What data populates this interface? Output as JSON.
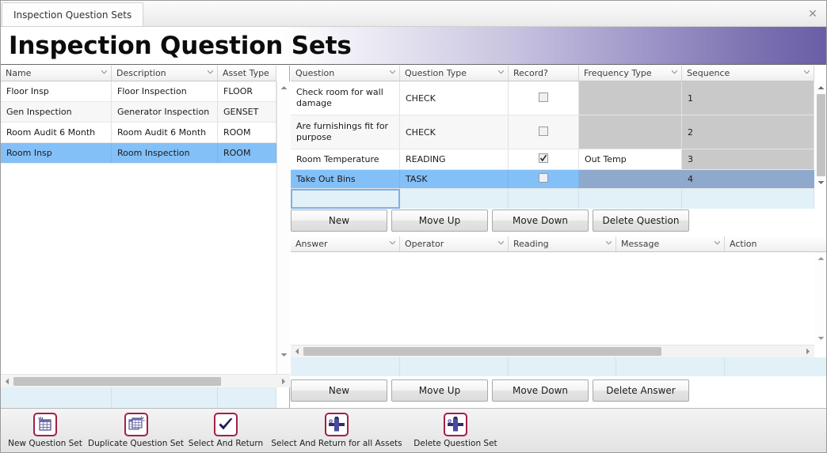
{
  "window": {
    "tab_title": "Inspection Question Sets",
    "close_label": "✕",
    "page_title": "Inspection Question Sets"
  },
  "question_sets_grid": {
    "columns": [
      {
        "label": "Name",
        "sortable": true
      },
      {
        "label": "Description",
        "sortable": true
      },
      {
        "label": "Asset Type",
        "sortable": false
      }
    ],
    "rows": [
      {
        "name": "Floor Insp",
        "description": "Floor Inspection",
        "asset_type": "FLOOR",
        "selected": false
      },
      {
        "name": "Gen Inspection",
        "description": "Generator Inspection",
        "asset_type": "GENSET",
        "selected": false
      },
      {
        "name": "Room Audit 6 Month",
        "description": "Room Audit 6 Month",
        "asset_type": "ROOM",
        "selected": false
      },
      {
        "name": "Room Insp",
        "description": "Room Inspection",
        "asset_type": "ROOM",
        "selected": true
      }
    ]
  },
  "questions_grid": {
    "columns": [
      {
        "label": "Question",
        "sortable": true
      },
      {
        "label": "Question Type",
        "sortable": true
      },
      {
        "label": "Record?",
        "sortable": false
      },
      {
        "label": "Frequency Type",
        "sortable": true
      },
      {
        "label": "Sequence",
        "sortable": true
      }
    ],
    "rows": [
      {
        "question": "Check room for wall damage",
        "question_type": "CHECK",
        "record": false,
        "frequency_type": "",
        "frequency_readonly": true,
        "sequence": "1",
        "selected": false
      },
      {
        "question": "Are furnishings fit for purpose",
        "question_type": "CHECK",
        "record": false,
        "frequency_type": "",
        "frequency_readonly": true,
        "sequence": "2",
        "selected": false
      },
      {
        "question": "Room Temperature",
        "question_type": "READING",
        "record": true,
        "frequency_type": "Out Temp",
        "frequency_readonly": false,
        "sequence": "3",
        "selected": false
      },
      {
        "question": "Take Out Bins",
        "question_type": "TASK",
        "record": false,
        "frequency_type": "",
        "frequency_readonly": false,
        "sequence": "4",
        "selected": true
      }
    ]
  },
  "questions_buttons": {
    "new": "New",
    "move_up": "Move Up",
    "move_down": "Move Down",
    "delete": "Delete Question"
  },
  "answers_grid": {
    "columns": [
      {
        "label": "Answer",
        "sortable": true
      },
      {
        "label": "Operator",
        "sortable": true
      },
      {
        "label": "Reading",
        "sortable": true
      },
      {
        "label": "Message",
        "sortable": true
      },
      {
        "label": "Action",
        "sortable": false
      }
    ],
    "rows": []
  },
  "answers_buttons": {
    "new": "New",
    "move_up": "Move Up",
    "move_down": "Move Down",
    "delete": "Delete Answer"
  },
  "toolbar": {
    "items": [
      {
        "label": "New Question Set",
        "icon": "new-grid-icon"
      },
      {
        "label": "Duplicate Question Set",
        "icon": "duplicate-grid-icon"
      },
      {
        "label": "Select And Return",
        "icon": "checkmark-icon"
      },
      {
        "label": "Select And Return for all Assets",
        "icon": "assets-icon"
      },
      {
        "label": "Delete Question Set",
        "icon": "delete-asset-icon"
      }
    ]
  },
  "colors": {
    "accent_purple": "#6a5da6",
    "selection_blue": "#84c0f8",
    "selection_readonly": "#8fa9cc",
    "readonly_gray": "#c9c9c9",
    "newrow_blue": "#e2f0f7",
    "icon_border": "#a32046"
  }
}
